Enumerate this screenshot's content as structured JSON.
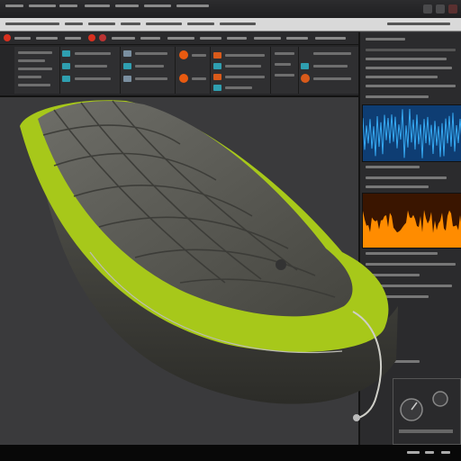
{
  "window": {
    "title": ""
  },
  "mixer": {
    "channel_count": 7
  },
  "colors": {
    "accent_record": "#d8301f",
    "wave_blue": "#36a9f2",
    "wave_orange": "#ff8c00",
    "bag_shell": "#5a5a55",
    "bag_trim": "#a7c81a"
  },
  "icons": [
    "record-icon",
    "play-icon",
    "stop-icon",
    "knob-icon",
    "close-icon",
    "minimize-icon",
    "maximize-icon"
  ],
  "scene": {
    "object": "sleeping-bag"
  }
}
